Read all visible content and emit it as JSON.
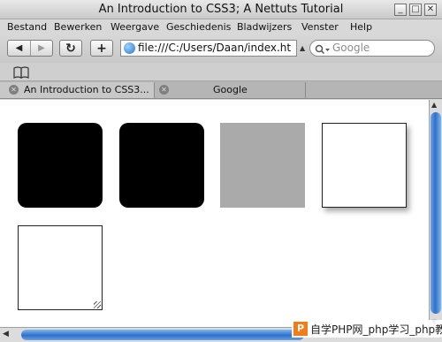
{
  "window": {
    "title": "An Introduction to CSS3; A Nettuts Tutorial"
  },
  "menu": [
    "Bestand",
    "Bewerken",
    "Weergave",
    "Geschiedenis",
    "Bladwijzers",
    "Venster",
    "Help"
  ],
  "toolbar": {
    "back_glyph": "◀",
    "forward_glyph": "▶",
    "reload_glyph": "↻",
    "add_glyph": "+",
    "url": "file:///C:/Users/Daan/index.ht",
    "search_placeholder": "Google"
  },
  "tabs": [
    {
      "label": "An Introduction to CSS3...",
      "active": true
    },
    {
      "label": "Google",
      "active": false
    }
  ],
  "watermark": {
    "logo": "P",
    "text": "自学PHP网_php学习_php教程"
  },
  "colors": {
    "box_black": "#000000",
    "box_gray": "#aaaaaa",
    "scroll_blue": "#2f6fc8"
  }
}
